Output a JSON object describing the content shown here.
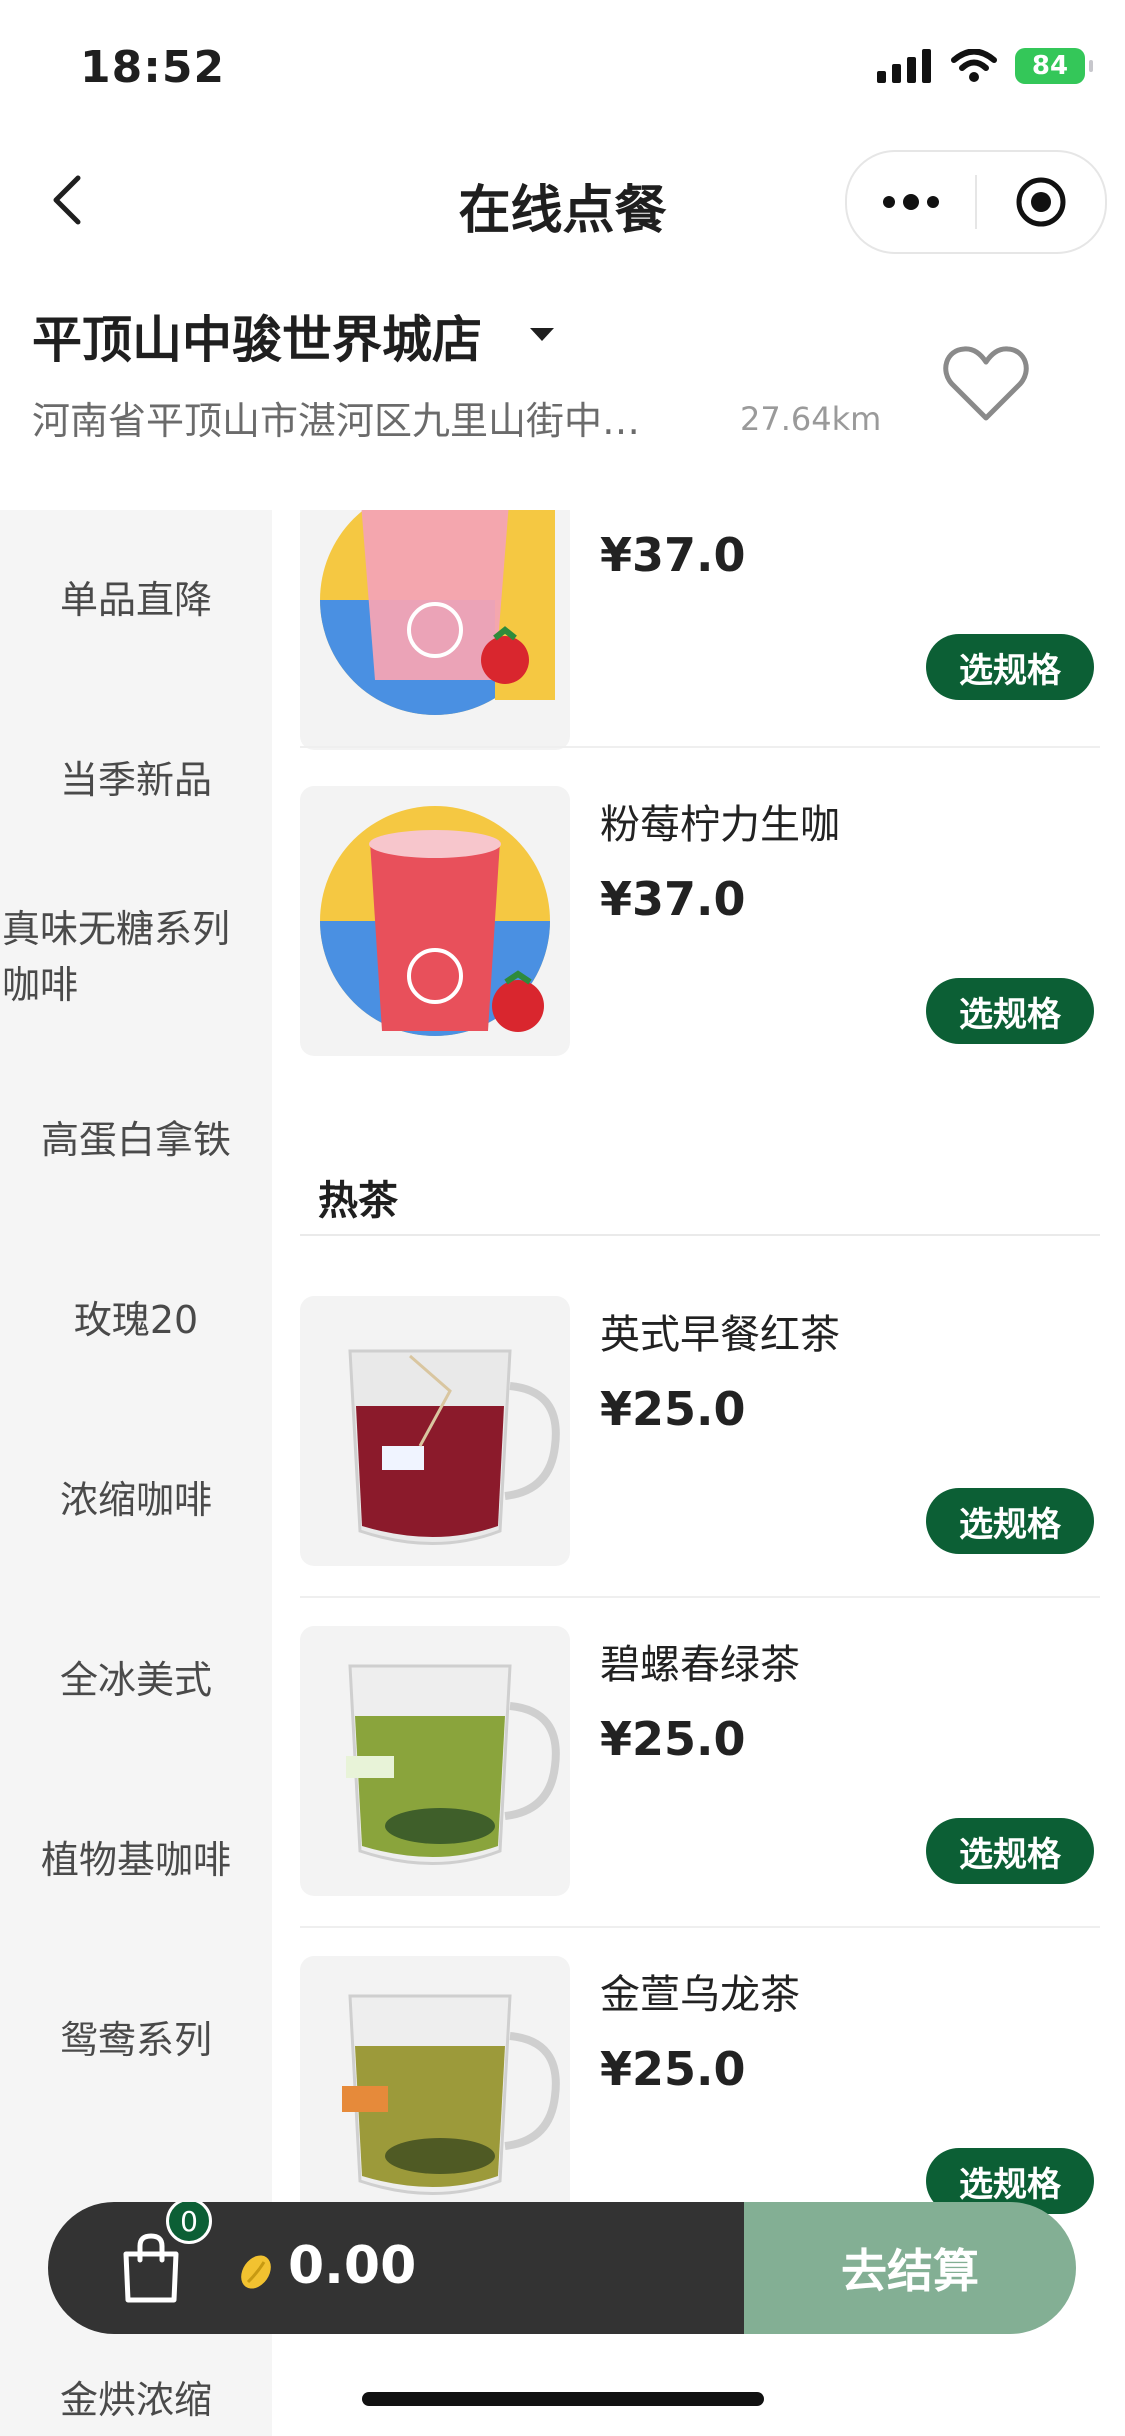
{
  "status_bar": {
    "time": "18:52",
    "battery": "84"
  },
  "nav": {
    "title": "在线点餐",
    "menu_icon": "more-dots-icon",
    "target_icon": "target-icon"
  },
  "store": {
    "name": "平顶山中骏世界城店",
    "address": "河南省平顶山市湛河区九里山街中…",
    "distance": "27.64km"
  },
  "categories": [
    "单品直降",
    "当季新品",
    "真味无糖系列",
    "咖啡",
    "高蛋白拿铁",
    "玫瑰20",
    "浓缩咖啡",
    "全冰美式",
    "植物基咖啡",
    "鸳鸯系列",
    "金烘浓缩"
  ],
  "products": [
    {
      "name": "",
      "price": "¥37.0",
      "button": "选规格"
    },
    {
      "name": "粉莓柠力生咖",
      "price": "¥37.0",
      "button": "选规格"
    },
    {
      "name": "英式早餐红茶",
      "price": "¥25.0",
      "button": "选规格"
    },
    {
      "name": "碧螺春绿茶",
      "price": "¥25.0",
      "button": "选规格"
    },
    {
      "name": "金萱乌龙茶",
      "price": "¥25.0",
      "button": "选规格"
    }
  ],
  "section": {
    "hot_tea": "热茶"
  },
  "cart": {
    "count": "0",
    "amount": "0.00",
    "checkout": "去结算"
  },
  "colors": {
    "brand_green": "#0c5f35",
    "checkout_green": "#83af94",
    "cart_dark": "#333333",
    "battery_green": "#34c759"
  }
}
